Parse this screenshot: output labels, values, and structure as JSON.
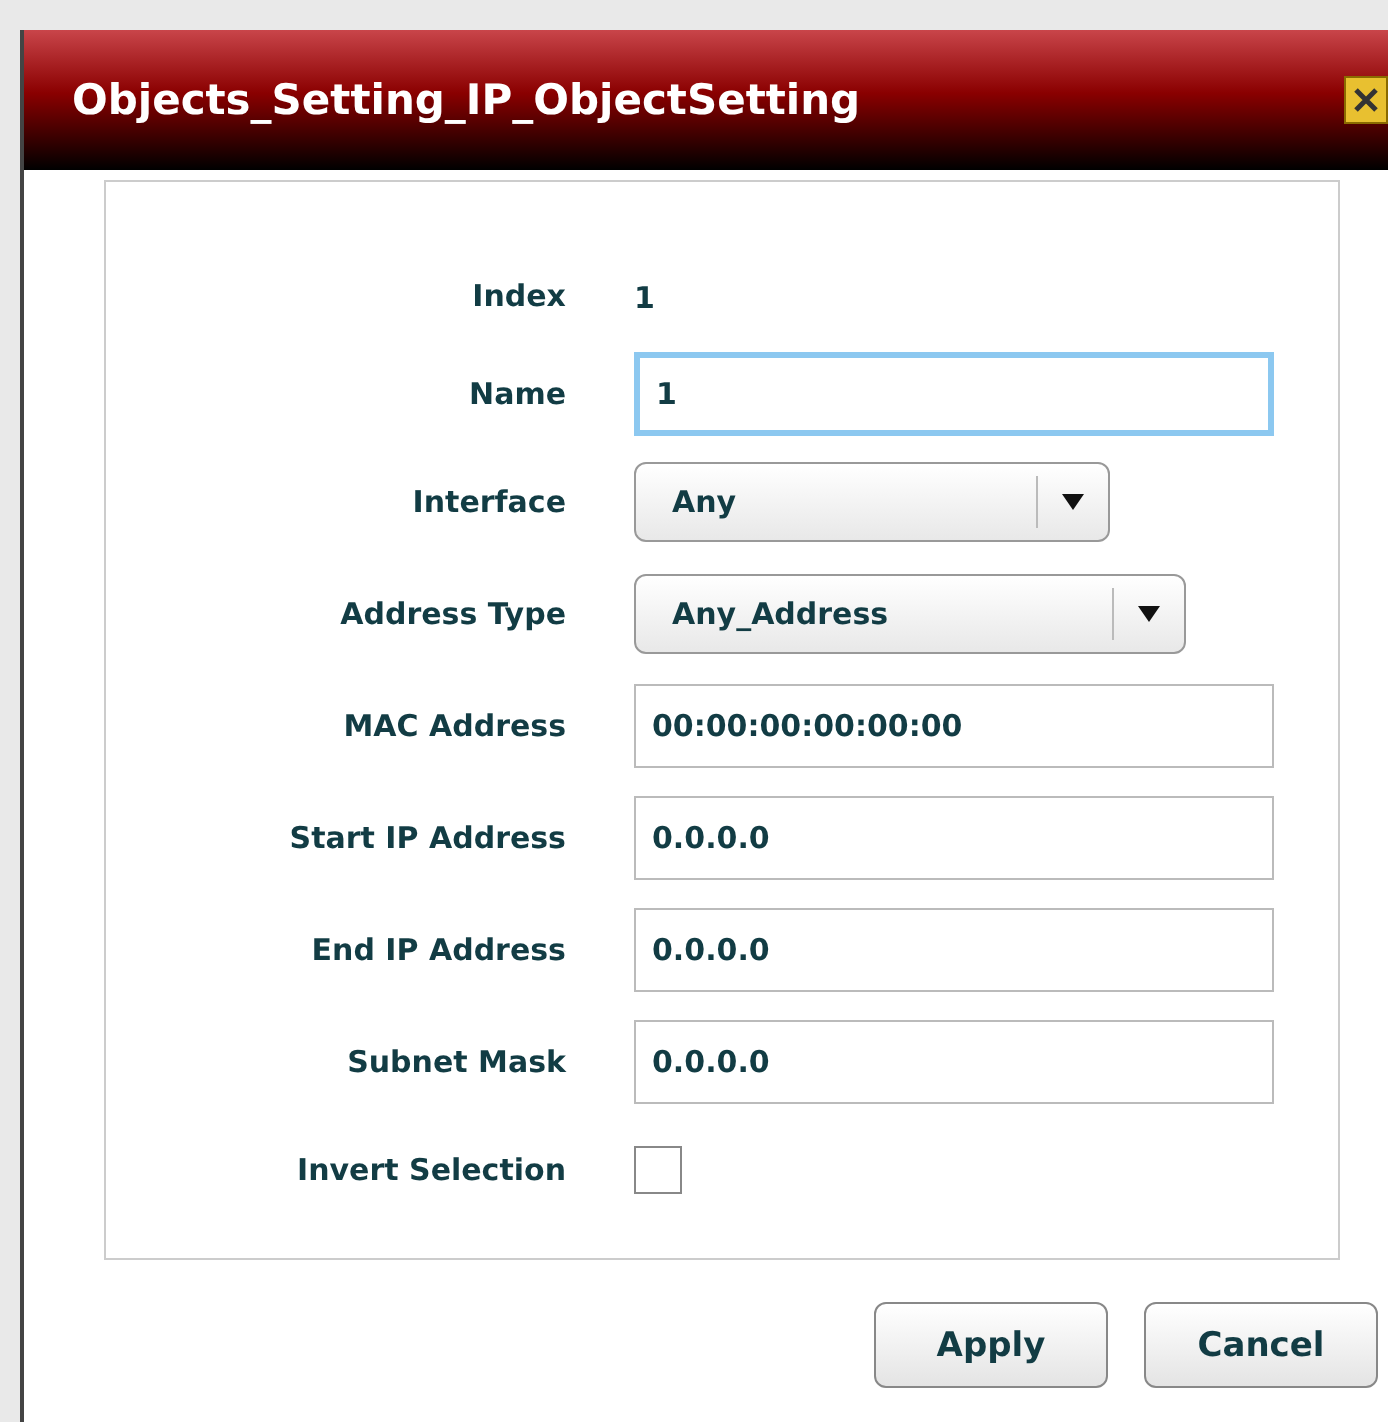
{
  "window": {
    "title": "Objects_Setting_IP_ObjectSetting"
  },
  "fields": [
    {
      "kind": "text",
      "label": "Index",
      "value": "1"
    },
    {
      "kind": "input",
      "label": "Name",
      "value": "1",
      "focused": true
    },
    {
      "kind": "select",
      "label": "Interface",
      "value": "Any"
    },
    {
      "kind": "select",
      "label": "Address Type",
      "value": "Any_Address"
    },
    {
      "kind": "input",
      "label": "MAC Address",
      "value": "00:00:00:00:00:00",
      "focused": false
    },
    {
      "kind": "input",
      "label": "Start IP Address",
      "value": "0.0.0.0",
      "focused": false
    },
    {
      "kind": "input",
      "label": "End IP Address",
      "value": "0.0.0.0",
      "focused": false
    },
    {
      "kind": "input",
      "label": "Subnet Mask",
      "value": "0.0.0.0",
      "focused": false
    },
    {
      "kind": "checkbox",
      "label": "Invert Selection",
      "checked": false
    }
  ],
  "buttons": [
    "Apply",
    "Cancel"
  ]
}
